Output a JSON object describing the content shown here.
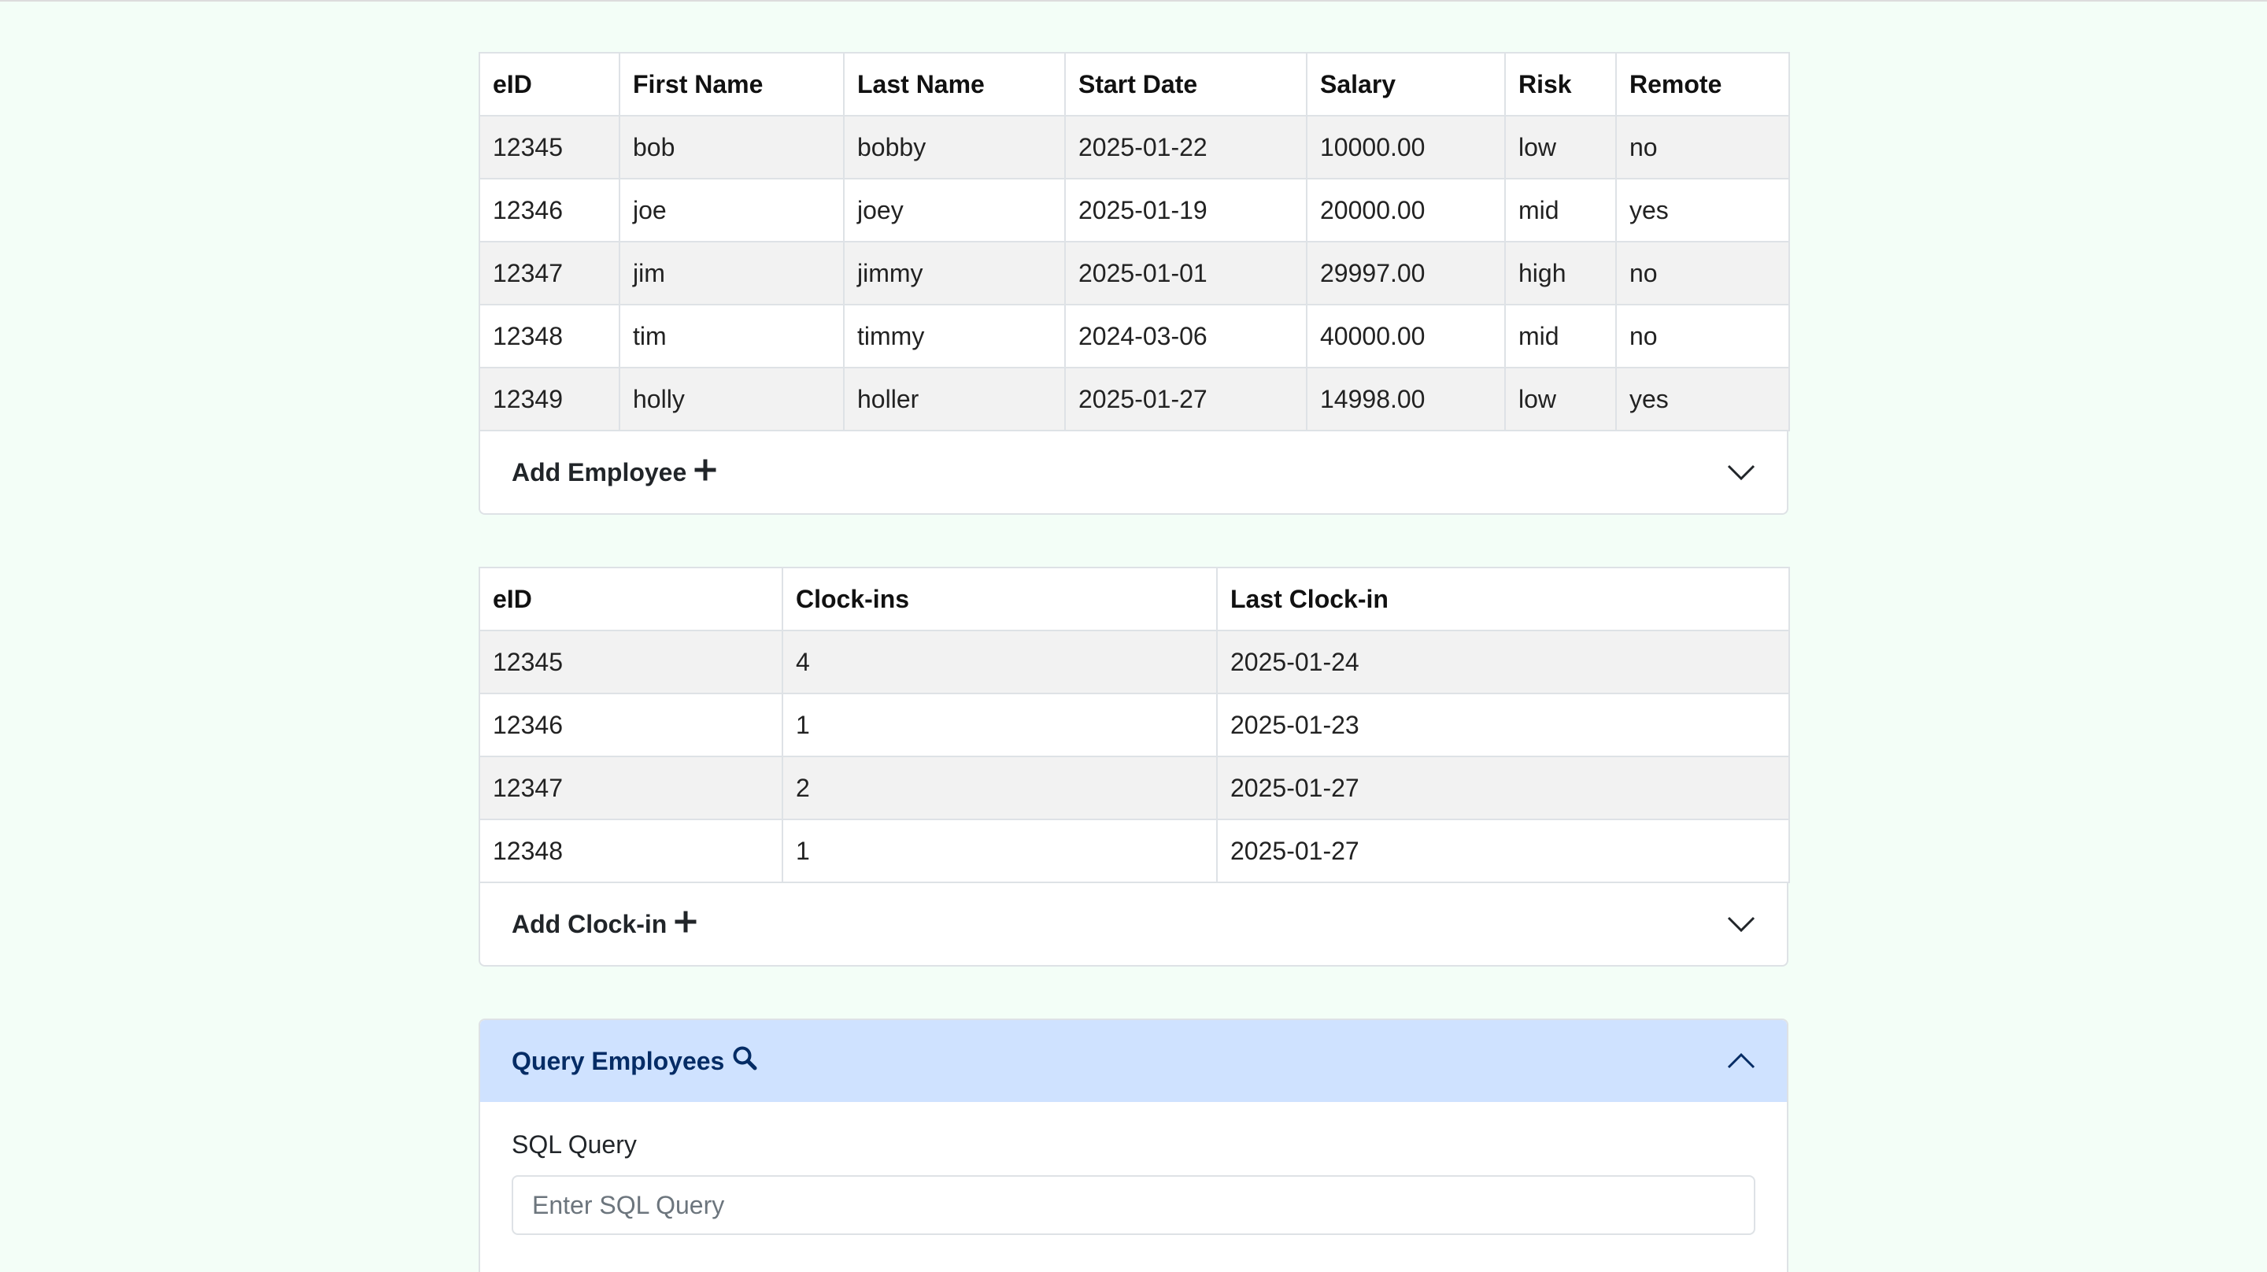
{
  "employees": {
    "columns": [
      "eID",
      "First Name",
      "Last Name",
      "Start Date",
      "Salary",
      "Risk",
      "Remote"
    ],
    "rows": [
      [
        "12345",
        "bob",
        "bobby",
        "2025-01-22",
        "10000.00",
        "low",
        "no"
      ],
      [
        "12346",
        "joe",
        "joey",
        "2025-01-19",
        "20000.00",
        "mid",
        "yes"
      ],
      [
        "12347",
        "jim",
        "jimmy",
        "2025-01-01",
        "29997.00",
        "high",
        "no"
      ],
      [
        "12348",
        "tim",
        "timmy",
        "2024-03-06",
        "40000.00",
        "mid",
        "no"
      ],
      [
        "12349",
        "holly",
        "holler",
        "2025-01-27",
        "14998.00",
        "low",
        "yes"
      ]
    ],
    "add_label": "Add Employee",
    "add_icon": "plus-icon",
    "toggle_icon": "chevron-down-icon"
  },
  "clockins": {
    "columns": [
      "eID",
      "Clock-ins",
      "Last Clock-in"
    ],
    "rows": [
      [
        "12345",
        "4",
        "2025-01-24"
      ],
      [
        "12346",
        "1",
        "2025-01-23"
      ],
      [
        "12347",
        "2",
        "2025-01-27"
      ],
      [
        "12348",
        "1",
        "2025-01-27"
      ]
    ],
    "add_label": "Add Clock-in",
    "add_icon": "plus-icon",
    "toggle_icon": "chevron-down-icon"
  },
  "query": {
    "title": "Query Employees",
    "title_icon": "search-icon",
    "toggle_icon": "chevron-up-icon",
    "field_label": "SQL Query",
    "placeholder": "Enter SQL Query"
  },
  "colors": {
    "page_bg": "#f3fef7",
    "stripe": "#f2f2f2",
    "border": "#dee2e6",
    "query_header_bg": "#cfe2ff",
    "query_header_text": "#052c65"
  }
}
